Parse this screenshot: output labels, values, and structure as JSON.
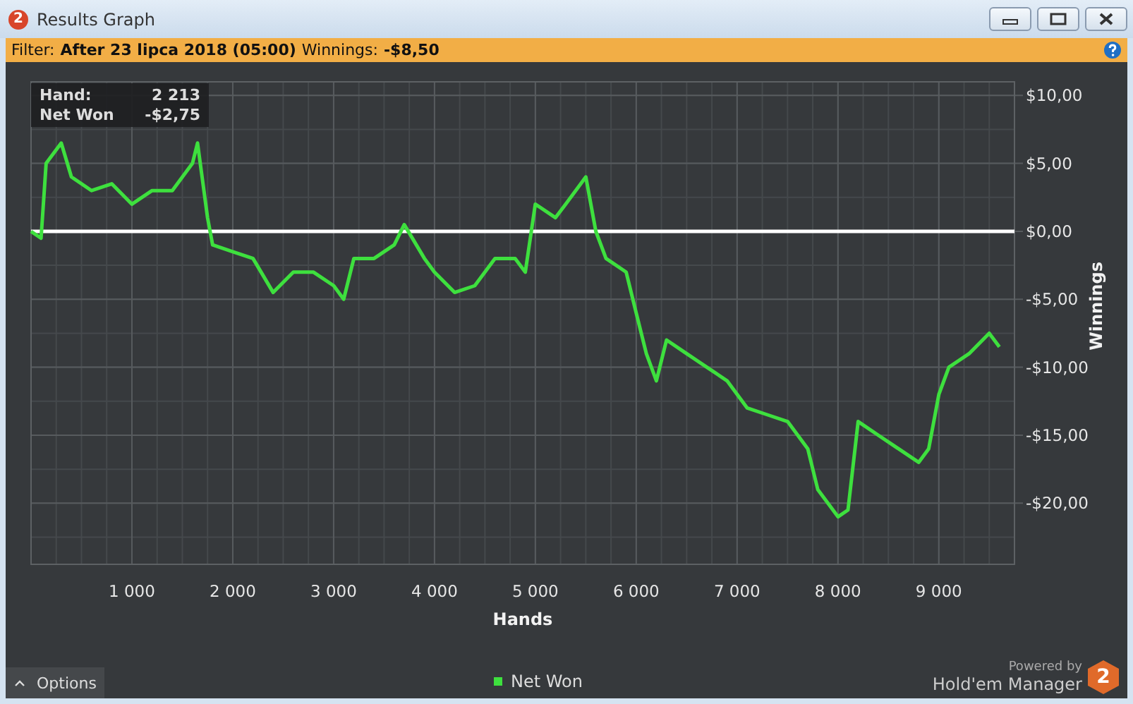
{
  "window": {
    "logo_text": "2",
    "title": "Results Graph"
  },
  "filter": {
    "label": "Filter:",
    "value": "After 23 lipca 2018 (05:00)",
    "winnings_label": "Winnings:",
    "winnings_value": "-$8,50"
  },
  "tooltip": [
    {
      "label": "Hand:",
      "value": "2 213"
    },
    {
      "label": "Net Won",
      "value": "-$2,75"
    }
  ],
  "chart_data": {
    "type": "line",
    "xlabel": "Hands",
    "ylabel": "Winnings",
    "xlim": [
      0,
      9750
    ],
    "ylim": [
      -24.5,
      11
    ],
    "xticks": [
      {
        "value": 1000,
        "label": "1 000"
      },
      {
        "value": 2000,
        "label": "2 000"
      },
      {
        "value": 3000,
        "label": "3 000"
      },
      {
        "value": 4000,
        "label": "4 000"
      },
      {
        "value": 5000,
        "label": "5 000"
      },
      {
        "value": 6000,
        "label": "6 000"
      },
      {
        "value": 7000,
        "label": "7 000"
      },
      {
        "value": 8000,
        "label": "8 000"
      },
      {
        "value": 9000,
        "label": "9 000"
      }
    ],
    "yticks": [
      {
        "value": 10,
        "label": "$10,00"
      },
      {
        "value": 5,
        "label": "$5,00"
      },
      {
        "value": 0,
        "label": "$0,00"
      },
      {
        "value": -5,
        "label": "-$5,00"
      },
      {
        "value": -10,
        "label": "-$10,00"
      },
      {
        "value": -15,
        "label": "-$15,00"
      },
      {
        "value": -20,
        "label": "-$20,00"
      }
    ],
    "x": [
      0,
      100,
      150,
      300,
      400,
      600,
      800,
      1000,
      1200,
      1400,
      1600,
      1650,
      1750,
      1800,
      2000,
      2200,
      2400,
      2600,
      2800,
      3000,
      3100,
      3200,
      3400,
      3600,
      3700,
      3900,
      4000,
      4200,
      4400,
      4600,
      4800,
      4900,
      5000,
      5200,
      5300,
      5500,
      5600,
      5700,
      5900,
      6000,
      6100,
      6200,
      6300,
      6500,
      6700,
      6900,
      7100,
      7300,
      7500,
      7700,
      7800,
      8000,
      8100,
      8200,
      8400,
      8600,
      8800,
      8900,
      9000,
      9100,
      9300,
      9500,
      9600
    ],
    "grid": true,
    "series": [
      {
        "name": "Net Won",
        "color": "#3ee03e",
        "values": [
          0,
          -0.5,
          5,
          6.5,
          4,
          3,
          3.5,
          2,
          3,
          3,
          5,
          6.5,
          1,
          -1,
          -1.5,
          -2,
          -4.5,
          -3,
          -3,
          -4,
          -5,
          -2,
          -2,
          -1,
          0.5,
          -2,
          -3,
          -4.5,
          -4,
          -2,
          -2,
          -3,
          2,
          1,
          2,
          4,
          0,
          -2,
          -3,
          -6,
          -9,
          -11,
          -8,
          -9,
          -10,
          -11,
          -13,
          -13.5,
          -14,
          -16,
          -19,
          -21,
          -20.5,
          -14,
          -15,
          -16,
          -17,
          -16,
          -12,
          -10,
          -9,
          -7.5,
          -8.5
        ]
      }
    ]
  },
  "options_button": {
    "label": "Options"
  },
  "branding": {
    "powered_by": "Powered by",
    "name": "Hold'em Manager",
    "logo_text": "2"
  }
}
